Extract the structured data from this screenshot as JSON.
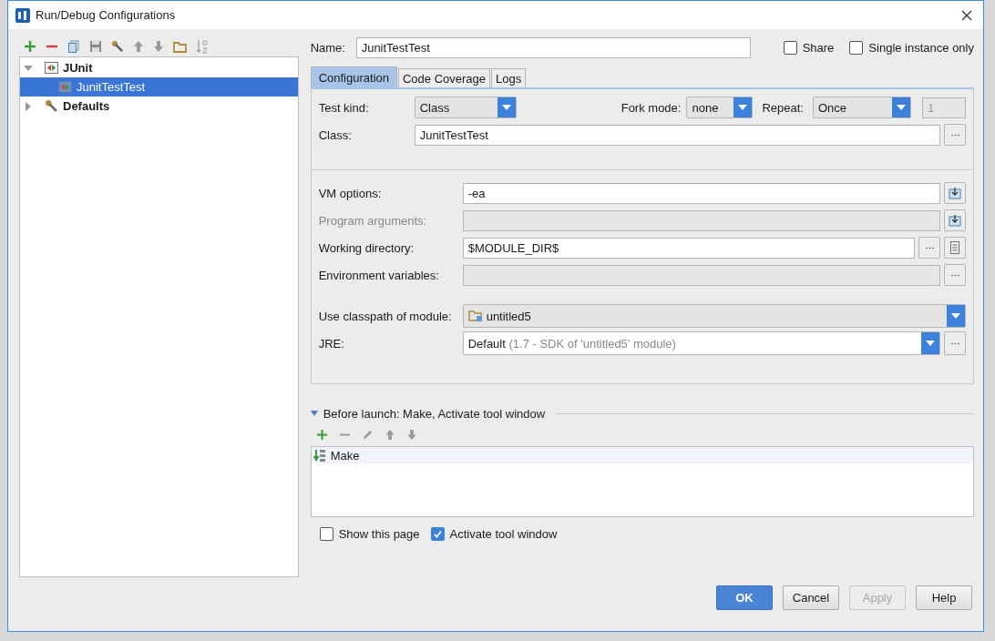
{
  "window": {
    "title": "Run/Debug Configurations"
  },
  "tree": [
    {
      "label": "JUnit",
      "expanded": true,
      "selected": false,
      "children": [
        {
          "label": "JunitTestTest",
          "selected": true
        }
      ]
    },
    {
      "label": "Defaults",
      "expanded": false,
      "selected": false
    }
  ],
  "name": {
    "label": "Name:",
    "value": "JunitTestTest"
  },
  "options": [
    {
      "label": "Share",
      "checked": false
    },
    {
      "label": "Single instance only",
      "checked": false
    }
  ],
  "tabs": [
    {
      "label": "Configuration",
      "selected": true
    },
    {
      "label": "Code Coverage",
      "selected": false
    },
    {
      "label": "Logs",
      "selected": false
    }
  ],
  "test_kind": {
    "label": "Test kind:",
    "value": "Class"
  },
  "fork_mode": {
    "label": "Fork mode:",
    "value": "none"
  },
  "repeat": {
    "label": "Repeat:",
    "value": "Once",
    "count": "1"
  },
  "class": {
    "label": "Class:",
    "value": "JunitTestTest"
  },
  "fields": [
    {
      "label": "VM options:",
      "value": "-ea",
      "disabled": false,
      "kind": "expand"
    },
    {
      "label": "Program arguments:",
      "disabled": true,
      "kind": "expand"
    },
    {
      "label": "Working directory:",
      "value": "$MODULE_DIR$",
      "disabled": false,
      "kind": "browse_list"
    },
    {
      "label": "Environment variables:",
      "disabled": false,
      "kind": "browse"
    }
  ],
  "module": {
    "label": "Use classpath of module:",
    "value": "untitled5"
  },
  "jre": {
    "label": "JRE:",
    "value": "Default",
    "detail": "(1.7 - SDK of 'untitled5' module)"
  },
  "before_launch": {
    "title": "Before launch: Make, Activate tool window",
    "expanded": true,
    "items": [
      {
        "label": "Make",
        "selected": true
      }
    ]
  },
  "launch_options": [
    {
      "label": "Show this page",
      "checked": false
    },
    {
      "label": "Activate tool window",
      "checked": true
    }
  ],
  "buttons": [
    {
      "label": "OK",
      "default": true,
      "disabled": false
    },
    {
      "label": "Cancel",
      "default": false,
      "disabled": false
    },
    {
      "label": "Apply",
      "default": false,
      "disabled": true
    },
    {
      "label": "Help",
      "default": false,
      "disabled": false
    }
  ]
}
